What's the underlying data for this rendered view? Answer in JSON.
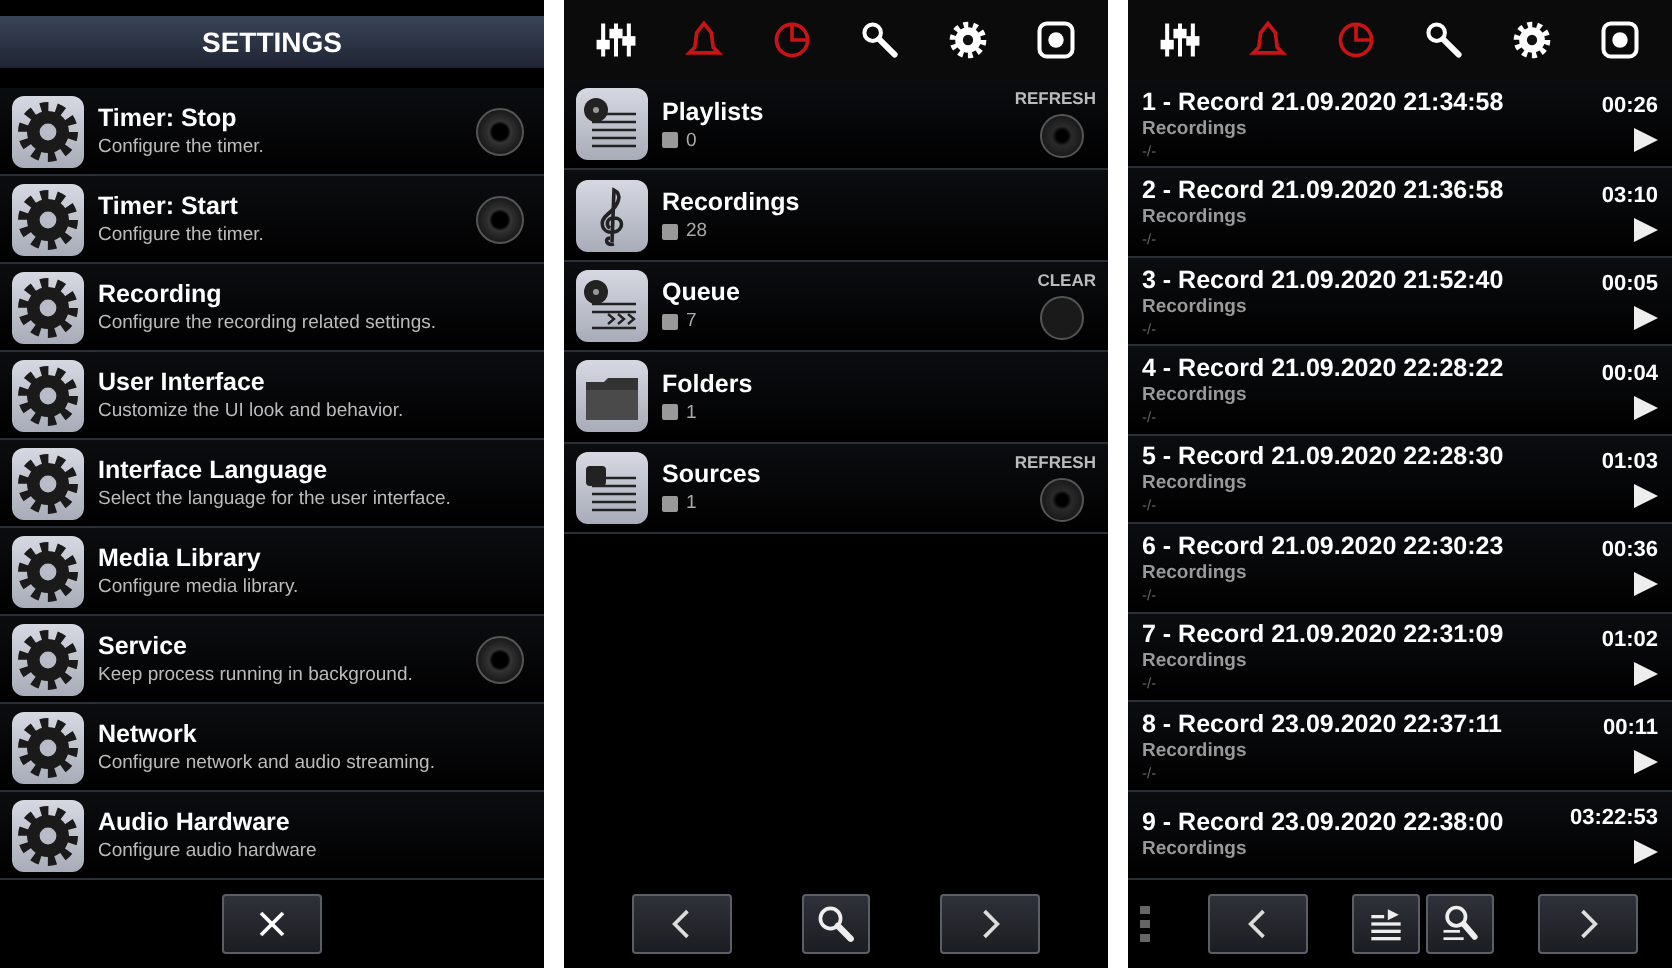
{
  "settings_panel": {
    "title": "SETTINGS",
    "items": [
      {
        "title": "Timer: Stop",
        "description": "Configure the timer.",
        "kind": "toggle",
        "on": false
      },
      {
        "title": "Timer: Start",
        "description": "Configure the timer.",
        "kind": "toggle",
        "on": false
      },
      {
        "title": "Recording",
        "description": "Configure the recording related settings.",
        "kind": "link"
      },
      {
        "title": "User Interface",
        "description": "Customize the UI look and behavior.",
        "kind": "link"
      },
      {
        "title": "Interface Language",
        "description": "Select the language for the user interface.",
        "kind": "link"
      },
      {
        "title": "Media Library",
        "description": "Configure media library.",
        "kind": "link"
      },
      {
        "title": "Service",
        "description": "Keep process running in background.",
        "kind": "toggle",
        "on": false
      },
      {
        "title": "Network",
        "description": "Configure network and audio streaming.",
        "kind": "link"
      },
      {
        "title": "Audio Hardware",
        "description": "Configure audio hardware",
        "kind": "link"
      }
    ],
    "bottom_bar": [
      {
        "kind": "close"
      }
    ]
  },
  "library_panel": {
    "toolbar": [
      {
        "kind": "mixer",
        "color": "#ffffff"
      },
      {
        "kind": "bell",
        "color": "#c81414"
      },
      {
        "kind": "pie",
        "color": "#c81414"
      },
      {
        "kind": "key",
        "color": "#ffffff"
      },
      {
        "kind": "gear",
        "color": "#ffffff"
      },
      {
        "kind": "record",
        "color": "#ffffff"
      }
    ],
    "items": [
      {
        "title": "Playlists",
        "count": "0",
        "kind": "playlist",
        "action": "REFRESH"
      },
      {
        "title": "Recordings",
        "count": "28",
        "kind": "clef"
      },
      {
        "title": "Queue",
        "count": "7",
        "kind": "queue",
        "action": "CLEAR"
      },
      {
        "title": "Folders",
        "count": "1",
        "kind": "folder"
      },
      {
        "title": "Sources",
        "count": "1",
        "kind": "sources",
        "action": "REFRESH"
      }
    ],
    "bottom_bar": [
      {
        "kind": "prev"
      },
      {
        "kind": "search"
      },
      {
        "kind": "next"
      }
    ]
  },
  "recordings_panel": {
    "toolbar": [
      {
        "kind": "mixer",
        "color": "#ffffff"
      },
      {
        "kind": "bell",
        "color": "#c81414"
      },
      {
        "kind": "pie",
        "color": "#c81414"
      },
      {
        "kind": "key",
        "color": "#ffffff"
      },
      {
        "kind": "gear",
        "color": "#ffffff"
      },
      {
        "kind": "record",
        "color": "#ffffff"
      }
    ],
    "items": [
      {
        "title": "1 - Record 21.09.2020 21:34:58",
        "folder": "Recordings",
        "info": "-/-",
        "duration": "00:26"
      },
      {
        "title": "2 - Record 21.09.2020 21:36:58",
        "folder": "Recordings",
        "info": "-/-",
        "duration": "03:10"
      },
      {
        "title": "3 - Record 21.09.2020 21:52:40",
        "folder": "Recordings",
        "info": "-/-",
        "duration": "00:05"
      },
      {
        "title": "4 - Record 21.09.2020 22:28:22",
        "folder": "Recordings",
        "info": "-/-",
        "duration": "00:04"
      },
      {
        "title": "5 - Record 21.09.2020 22:28:30",
        "folder": "Recordings",
        "info": "-/-",
        "duration": "01:03"
      },
      {
        "title": "6 - Record 21.09.2020 22:30:23",
        "folder": "Recordings",
        "info": "-/-",
        "duration": "00:36"
      },
      {
        "title": "7 - Record 21.09.2020 22:31:09",
        "folder": "Recordings",
        "info": "-/-",
        "duration": "01:02"
      },
      {
        "title": "8 - Record 23.09.2020 22:37:11",
        "folder": "Recordings",
        "info": "-/-",
        "duration": "00:11"
      },
      {
        "title": "9 - Record 23.09.2020 22:38:00",
        "folder": "Recordings",
        "duration": "03:22:53"
      }
    ],
    "bottom_bar": [
      {
        "kind": "menu"
      },
      {
        "kind": "prev"
      },
      {
        "kind": "playlist"
      },
      {
        "kind": "search-list"
      },
      {
        "kind": "next"
      }
    ]
  }
}
